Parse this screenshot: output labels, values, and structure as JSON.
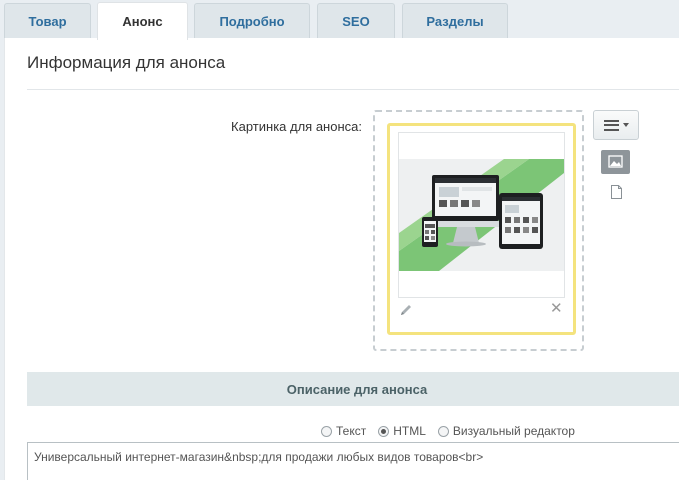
{
  "tabs": [
    {
      "label": "Товар",
      "active": false
    },
    {
      "label": "Анонс",
      "active": true
    },
    {
      "label": "Подробно",
      "active": false
    },
    {
      "label": "SEO",
      "active": false
    },
    {
      "label": "Разделы",
      "active": false
    }
  ],
  "section": {
    "title": "Информация для анонса"
  },
  "preview_image": {
    "label": "Картинка для анонса:",
    "edit_icon": "pencil-icon",
    "remove_icon": "close-icon"
  },
  "tools": {
    "menu_icon": "hamburger-icon",
    "image_icon": "image-icon",
    "file_icon": "file-icon"
  },
  "description": {
    "title": "Описание для анонса",
    "modes": [
      {
        "label": "Текст",
        "checked": false
      },
      {
        "label": "HTML",
        "checked": true
      },
      {
        "label": "Визуальный редактор",
        "checked": false
      }
    ],
    "value": "Универсальный интернет-магазин&nbsp;для продажи любых видов товаров<br>"
  },
  "colors": {
    "tab_link": "#2f6e9e",
    "card_highlight": "#f4e37e",
    "header_bar": "#e0e8ea",
    "page_bg": "#e9eef2"
  }
}
